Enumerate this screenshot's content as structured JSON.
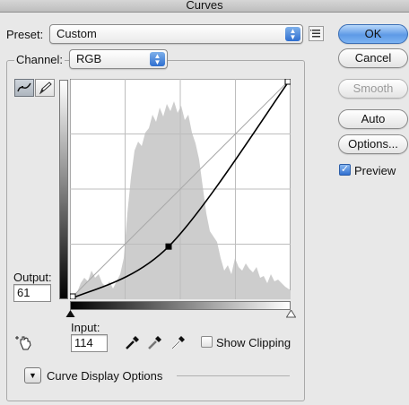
{
  "window": {
    "title": "Curves"
  },
  "preset": {
    "label": "Preset:",
    "value": "Custom"
  },
  "channel": {
    "label": "Channel:",
    "value": "RGB"
  },
  "buttons": {
    "ok": "OK",
    "cancel": "Cancel",
    "smooth": "Smooth",
    "auto": "Auto",
    "options": "Options..."
  },
  "preview": {
    "label": "Preview",
    "checked": true
  },
  "output": {
    "label": "Output:",
    "value": "61"
  },
  "input": {
    "label": "Input:",
    "value": "114"
  },
  "show_clipping": {
    "label": "Show Clipping",
    "checked": false
  },
  "curve_display": {
    "label": "Curve Display Options"
  },
  "curve": {
    "control_points": [
      {
        "input": 0,
        "output": 0
      },
      {
        "input": 114,
        "output": 61
      },
      {
        "input": 255,
        "output": 255
      }
    ]
  },
  "icons": {
    "preset_options": "list-menu-icon",
    "curve_tool": "curve-pencil-tool-icon",
    "pencil_tool": "pencil-icon",
    "hand_tool": "targeted-adjustment-hand-icon",
    "eyedroppers": [
      "black-point-eyedropper-icon",
      "gray-point-eyedropper-icon",
      "white-point-eyedropper-icon"
    ]
  }
}
